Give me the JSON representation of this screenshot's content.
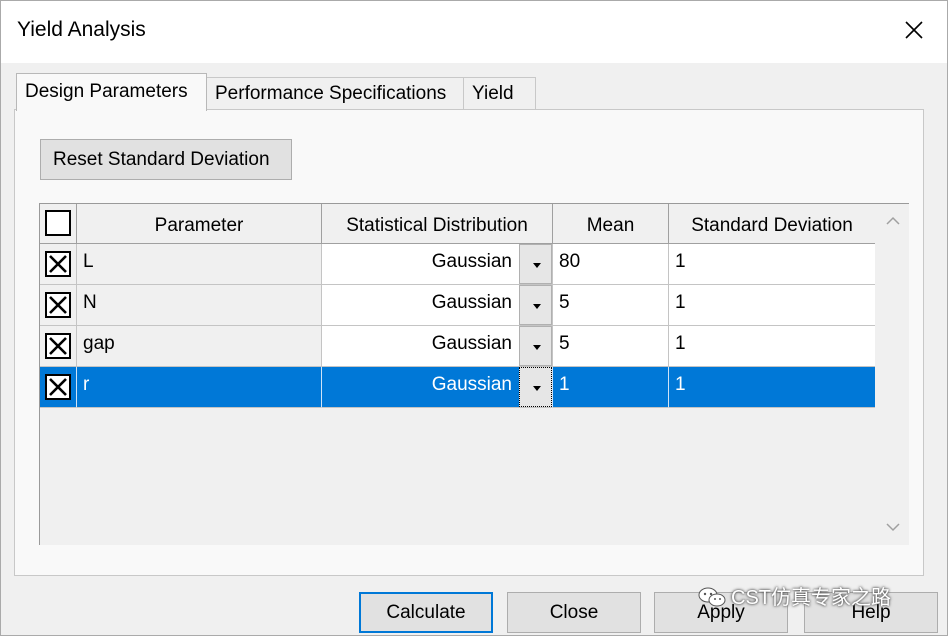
{
  "window": {
    "title": "Yield Analysis"
  },
  "tabs": [
    {
      "label": "Design Parameters",
      "active": true
    },
    {
      "label": "Performance Specifications",
      "active": false
    },
    {
      "label": "Yield",
      "active": false
    }
  ],
  "reset_button": {
    "label": "Reset Standard Deviation"
  },
  "table": {
    "header_checked": false,
    "columns": [
      "Parameter",
      "Statistical Distribution",
      "Mean",
      "Standard Deviation"
    ],
    "rows": [
      {
        "checked": true,
        "parameter": "L",
        "distribution": "Gaussian",
        "mean": "80",
        "std": "1",
        "selected": false
      },
      {
        "checked": true,
        "parameter": "N",
        "distribution": "Gaussian",
        "mean": "5",
        "std": "1",
        "selected": false
      },
      {
        "checked": true,
        "parameter": "gap",
        "distribution": "Gaussian",
        "mean": "5",
        "std": "1",
        "selected": false
      },
      {
        "checked": true,
        "parameter": "r",
        "distribution": "Gaussian",
        "mean": "1",
        "std": "1",
        "selected": true
      }
    ]
  },
  "buttons": {
    "calculate": "Calculate",
    "close": "Close",
    "apply": "Apply",
    "help": "Help"
  },
  "watermark": {
    "text": "CST仿真专家之路",
    "icon": "wechat-icon"
  },
  "colors": {
    "selection": "#0078d7",
    "default_button_border": "#0078d7"
  }
}
